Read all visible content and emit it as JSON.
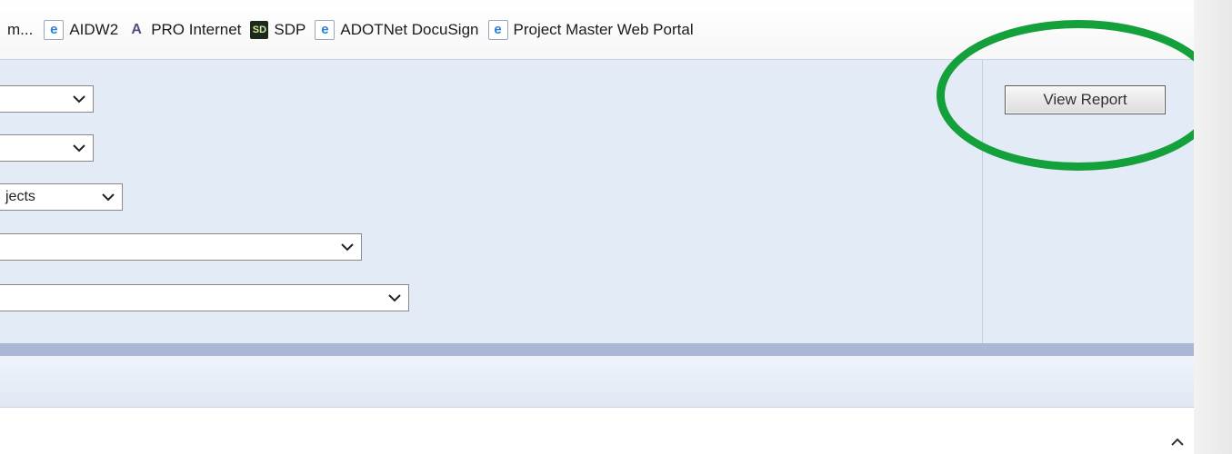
{
  "favorites": [
    {
      "label": "m...",
      "icon": "none"
    },
    {
      "label": "AIDW2",
      "icon": "ie-icon"
    },
    {
      "label": "PRO Internet",
      "icon": "pro-icon"
    },
    {
      "label": "SDP",
      "icon": "sdp-icon"
    },
    {
      "label": "ADOTNet DocuSign",
      "icon": "ie-icon"
    },
    {
      "label": "Project Master Web Portal",
      "icon": "ie-icon"
    }
  ],
  "params": {
    "dropdown1": {
      "value": ""
    },
    "dropdown2": {
      "value": ""
    },
    "dropdown3": {
      "value": "jects"
    },
    "dropdown4": {
      "value": ""
    },
    "dropdown5": {
      "value": ""
    }
  },
  "view_report": {
    "label": "View Report"
  },
  "colors": {
    "panel_bg": "#e3ebf7",
    "band": "#aab8d6",
    "annotation_circle": "#14a03a"
  }
}
